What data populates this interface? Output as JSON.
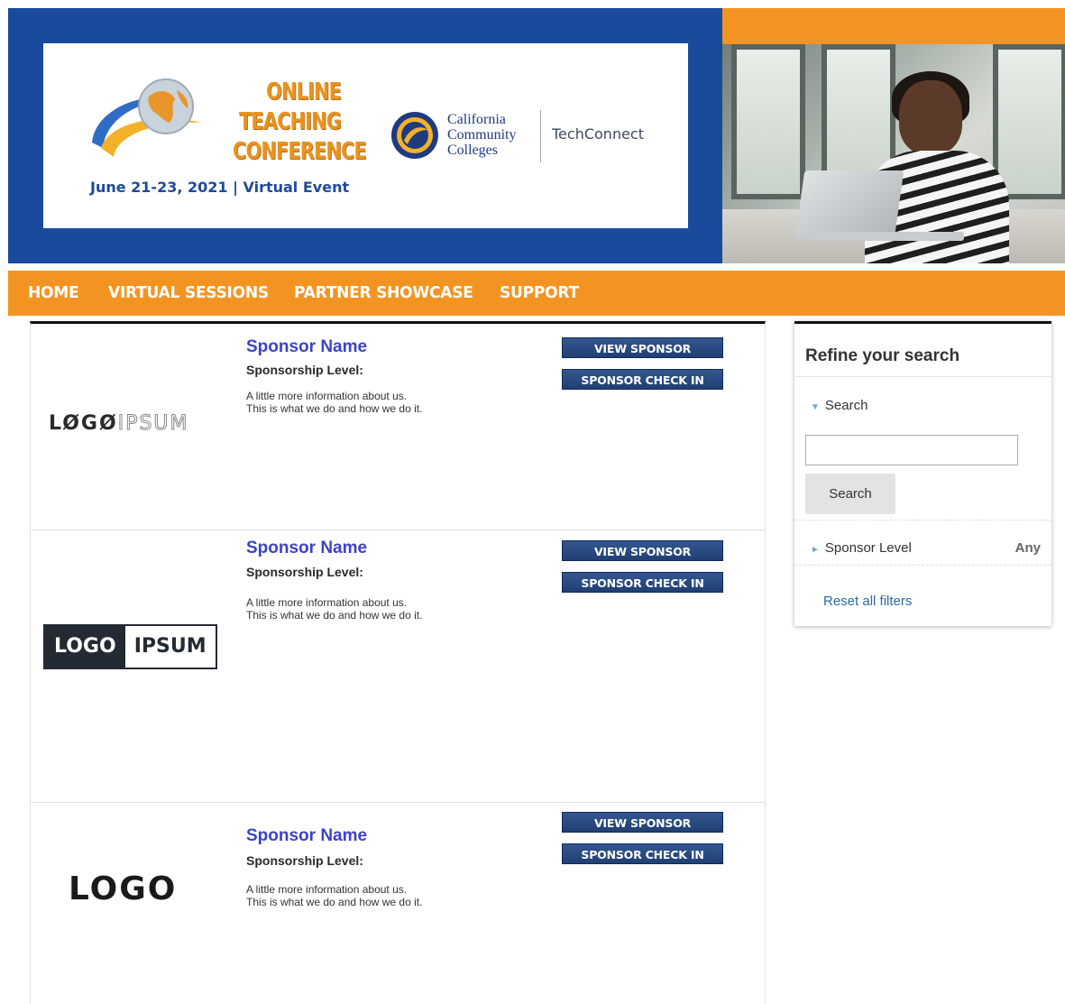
{
  "header": {
    "conference_title_lines": [
      "ONLINE",
      "TEACHING",
      "CONFERENCE"
    ],
    "conference_date": "June 21-23, 2021 | Virtual Event",
    "org_name_lines": [
      "California",
      "Community",
      "Colleges"
    ],
    "partner_name": "TechConnect"
  },
  "colors": {
    "brand_blue": "#1a4a9b",
    "brand_orange": "#f39422",
    "sponsor_name": "#3a43c8",
    "button_navy": "#203f74",
    "link": "#2a6aa8"
  },
  "nav": {
    "items": [
      "HOME",
      "VIRTUAL SESSIONS",
      "PARTNER SHOWCASE",
      "SUPPORT"
    ]
  },
  "sponsors": [
    {
      "name": "Sponsor Name",
      "level_label": "Sponsorship Level:",
      "desc_line1": "A little more information about us.",
      "desc_line2": "This is what we do and how we do it.",
      "view_button": "VIEW SPONSOR",
      "checkin_button": "SPONSOR CHECK IN",
      "logo_part1": "LØGØ",
      "logo_part2": "IPSUM"
    },
    {
      "name": "Sponsor Name",
      "level_label": "Sponsorship Level:",
      "desc_line1": "A little more information about us.",
      "desc_line2": "This is what we do and how we do it.",
      "view_button": "VIEW SPONSOR",
      "checkin_button": "SPONSOR CHECK IN",
      "logo_part1": "LOGO",
      "logo_part2": "IPSUM"
    },
    {
      "name": "Sponsor Name",
      "level_label": "Sponsorship Level:",
      "desc_line1": "A little more information about us.",
      "desc_line2": "This is what we do and how we do it.",
      "view_button": "VIEW SPONSOR",
      "checkin_button": "SPONSOR CHECK IN",
      "logo_part1": "LOGO",
      "logo_part2": ""
    }
  ],
  "refine": {
    "title": "Refine your search",
    "search_label": "Search",
    "search_value": "",
    "search_button": "Search",
    "level_label": "Sponsor Level",
    "level_value": "Any",
    "reset_link": "Reset all filters"
  }
}
